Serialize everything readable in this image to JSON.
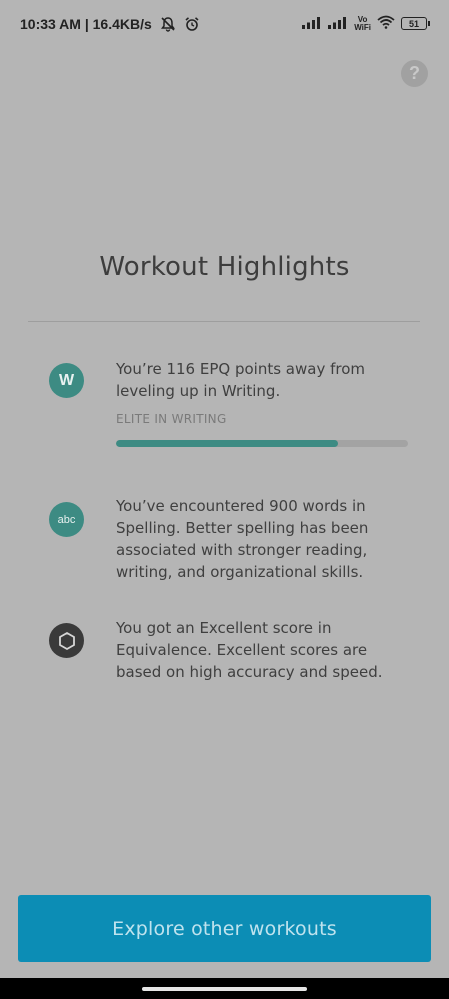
{
  "status_bar": {
    "time_speed": "10:33 AM | 16.4KB/s",
    "battery": "51",
    "vowifi_top": "Vo",
    "vowifi_bottom": "WiFi"
  },
  "help": {
    "label": "?"
  },
  "title": "Workout Highlights",
  "highlights": [
    {
      "icon_text": "W",
      "text": "You’re 116 EPQ points away from leveling up in Writing.",
      "level_label": "ELITE IN WRITING",
      "progress": 0.76
    },
    {
      "icon_text": "abc",
      "text": "You’ve encountered 900 words in Spelling. Better spelling has been associated with stronger reading, writing, and organizational skills."
    },
    {
      "icon_text": "",
      "text": "You got an Excellent score in Equivalence. Excellent scores are based on high accuracy and speed."
    }
  ],
  "button": {
    "label": "Explore other workouts"
  },
  "colors": {
    "background": "#b5b5b5",
    "accent_teal": "#3d8b83",
    "button_blue": "#0c8db5"
  },
  "icons": {
    "mute_notifications": "bell-off-icon",
    "alarm": "alarm-clock-icon",
    "signal": "signal-bars-icon",
    "wifi": "wifi-icon",
    "equivalence": "hexagon-icon"
  }
}
